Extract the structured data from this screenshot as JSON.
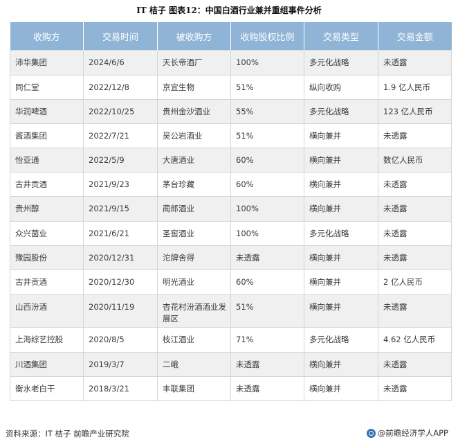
{
  "title": "IT 桔子  图表12：中国白酒行业兼并重组事件分析",
  "table": {
    "headers": [
      "收购方",
      "交易时间",
      "被收购方",
      "收购股权比例",
      "交易类型",
      "交易金额"
    ],
    "rows": [
      [
        "沛华集团",
        "2024/6/6",
        "天长帝酒厂",
        "100%",
        "多元化战略",
        "未透露"
      ],
      [
        "同仁堂",
        "2022/12/8",
        "京宜生物",
        "51%",
        "纵向收购",
        "1.9 亿人民币"
      ],
      [
        "华润啤酒",
        "2022/10/25",
        "贵州金沙酒业",
        "55%",
        "多元化战略",
        "123 亿人民币"
      ],
      [
        "酱酒集团",
        "2022/7/21",
        "吴公岩酒业",
        "51%",
        "横向兼并",
        "未透露"
      ],
      [
        "怡亚通",
        "2022/5/9",
        "大唐酒业",
        "60%",
        "横向兼并",
        "数亿人民币"
      ],
      [
        "古井贡酒",
        "2021/9/23",
        "茅台珍藏",
        "60%",
        "横向兼并",
        "未透露"
      ],
      [
        "贵州醇",
        "2021/9/15",
        "蔺郎酒业",
        "100%",
        "横向兼并",
        "未透露"
      ],
      [
        "众兴菌业",
        "2021/6/21",
        "圣窖酒业",
        "100%",
        "多元化战略",
        "未透露"
      ],
      [
        "豫园股份",
        "2020/12/31",
        "沱牌舍得",
        "未透露",
        "横向兼并",
        "未透露"
      ],
      [
        "古井贡酒",
        "2020/12/30",
        "明光酒业",
        "60%",
        "横向兼并",
        "2 亿人民币"
      ],
      [
        "山西汾酒",
        "2020/11/19",
        "杏花村汾酒酒业发展区",
        "51%",
        "横向兼并",
        "未透露"
      ],
      [
        "上海综艺控股",
        "2020/8/5",
        "枝江酒业",
        "71%",
        "多元化战略",
        "4.62 亿人民币"
      ],
      [
        "川酒集团",
        "2019/3/7",
        "二峨",
        "未透露",
        "横向兼并",
        "未透露"
      ],
      [
        "衡水老白干",
        "2018/3/21",
        "丰联集团",
        "未透露",
        "横向兼并",
        "未透露"
      ]
    ]
  },
  "footer": {
    "source": "资料来源：IT 桔子 前瞻产业研究院",
    "brand": "@前瞻经济学人APP",
    "brand_icon": "qianzhan-logo-icon"
  }
}
